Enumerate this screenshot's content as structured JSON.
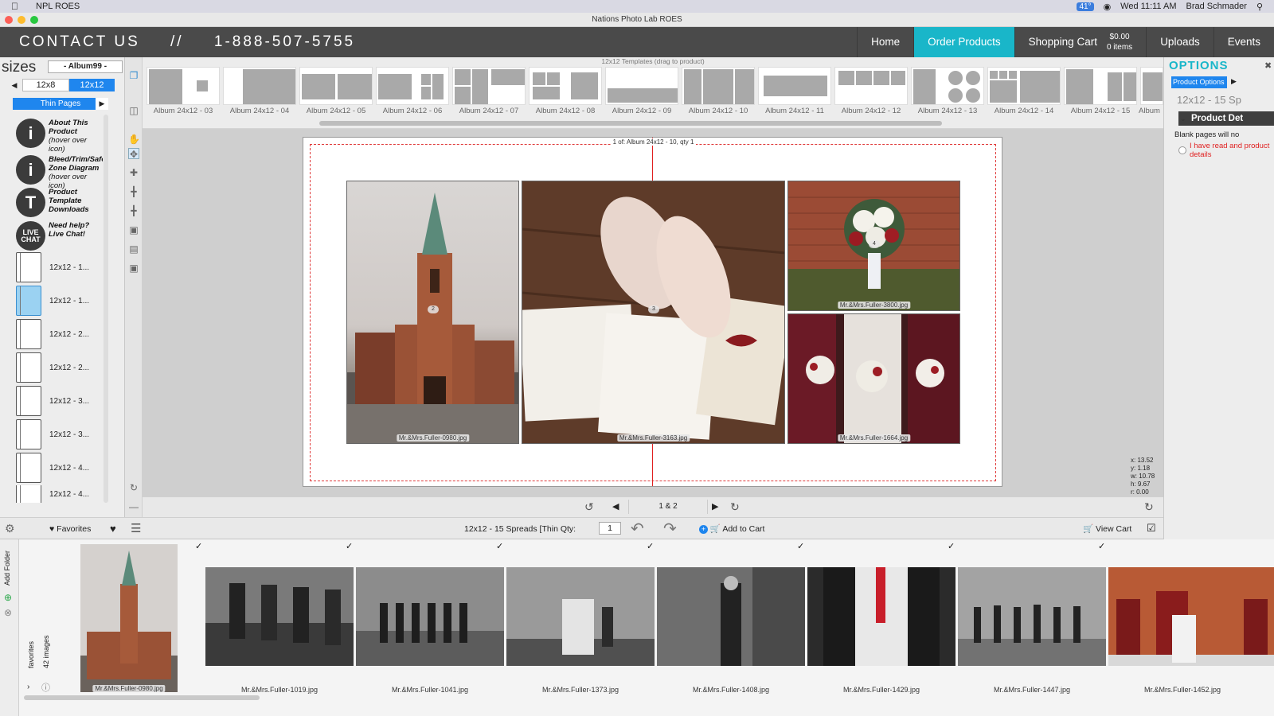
{
  "menubar": {
    "app_name": "NPL ROES",
    "temperature": "41°",
    "clock": "Wed 11:11 AM",
    "user": "Brad Schmader"
  },
  "window": {
    "title": "Nations Photo Lab ROES"
  },
  "header": {
    "contact": "CONTACT US",
    "separator": "//",
    "phone": "1-888-507-5755",
    "nav": {
      "home": "Home",
      "order": "Order Products",
      "cart": "Shopping Cart",
      "cart_total": "$0.00",
      "cart_items": "0 items",
      "uploads": "Uploads",
      "events": "Events"
    }
  },
  "sidebar": {
    "title": "sizes",
    "album_select": "- Album99 -",
    "size_tabs": [
      "12x8",
      "12x12"
    ],
    "page_type": "Thin Pages",
    "info": [
      {
        "icon": "i",
        "title": "About This Product",
        "note": "(hover over icon)"
      },
      {
        "icon": "i",
        "title": "Bleed/Trim/Safe Zone Diagram",
        "note": "(hover over icon)"
      },
      {
        "icon": "T",
        "title": "Product Template Downloads",
        "note": ""
      },
      {
        "icon": "LIVE CHAT",
        "title": "Need help? Live Chat!",
        "note": ""
      }
    ],
    "templates": [
      "12x12 - 1...",
      "12x12 - 1...",
      "12x12 - 2...",
      "12x12 - 2...",
      "12x12 - 3...",
      "12x12 - 3...",
      "12x12 - 4...",
      "12x12 - 4..."
    ]
  },
  "strip": {
    "title": "12x12 Templates (drag to product)",
    "labels": [
      "Album 24x12 - 03",
      "Album 24x12 - 04",
      "Album 24x12 - 05",
      "Album 24x12 - 06",
      "Album 24x12 - 07",
      "Album 24x12 - 08",
      "Album 24x12 - 09",
      "Album 24x12 - 10",
      "Album 24x12 - 11",
      "Album 24x12 - 12",
      "Album 24x12 - 13",
      "Album 24x12 - 14",
      "Album 24x12 - 15",
      "Album"
    ]
  },
  "canvas": {
    "page_caption": "1 of: Album 24x12 - 10, qty 1",
    "photos": [
      {
        "file": "Mr.&Mrs.Fuller-0980.jpg",
        "num": "2"
      },
      {
        "file": "Mr.&Mrs.Fuller-3163.jpg",
        "num": "3"
      },
      {
        "file": "Mr.&Mrs.Fuller-3800.jpg",
        "num": "4"
      },
      {
        "file": "Mr.&Mrs.Fuller-1664.jpg",
        "num": ""
      }
    ],
    "coords": [
      "x: 13.52",
      "y: 1.18",
      "w: 10.78",
      "h: 9.67",
      "r: 0.00"
    ]
  },
  "pager": {
    "page": "1 & 2"
  },
  "actionbar": {
    "favorites": "Favorites",
    "product_label": "12x12 - 15 Spreads [Thin Qty:",
    "qty": "1",
    "add_to_cart": "Add to Cart",
    "view_cart": "View Cart"
  },
  "rightpanel": {
    "title": "OPTIONS",
    "tab": "Product Options",
    "product": "12x12 - 15 Sp",
    "details_header": "Product Det",
    "blank_note": "Blank pages will no",
    "agree_text": "I have read and product details"
  },
  "filmstrip": {
    "add_folder": "Add Folder",
    "folder_name": "favorites",
    "count": "42 images",
    "thumbs": [
      "Mr.&Mrs.Fuller-0980.jpg",
      "Mr.&Mrs.Fuller-1019.jpg",
      "Mr.&Mrs.Fuller-1041.jpg",
      "Mr.&Mrs.Fuller-1373.jpg",
      "Mr.&Mrs.Fuller-1408.jpg",
      "Mr.&Mrs.Fuller-1429.jpg",
      "Mr.&Mrs.Fuller-1447.jpg",
      "Mr.&Mrs.Fuller-1452.jpg"
    ]
  },
  "colors": {
    "accent": "#19b6c9",
    "header_bg": "#4a4a4a",
    "selected_blue": "#1f86ee",
    "warning_red": "#e02020"
  }
}
